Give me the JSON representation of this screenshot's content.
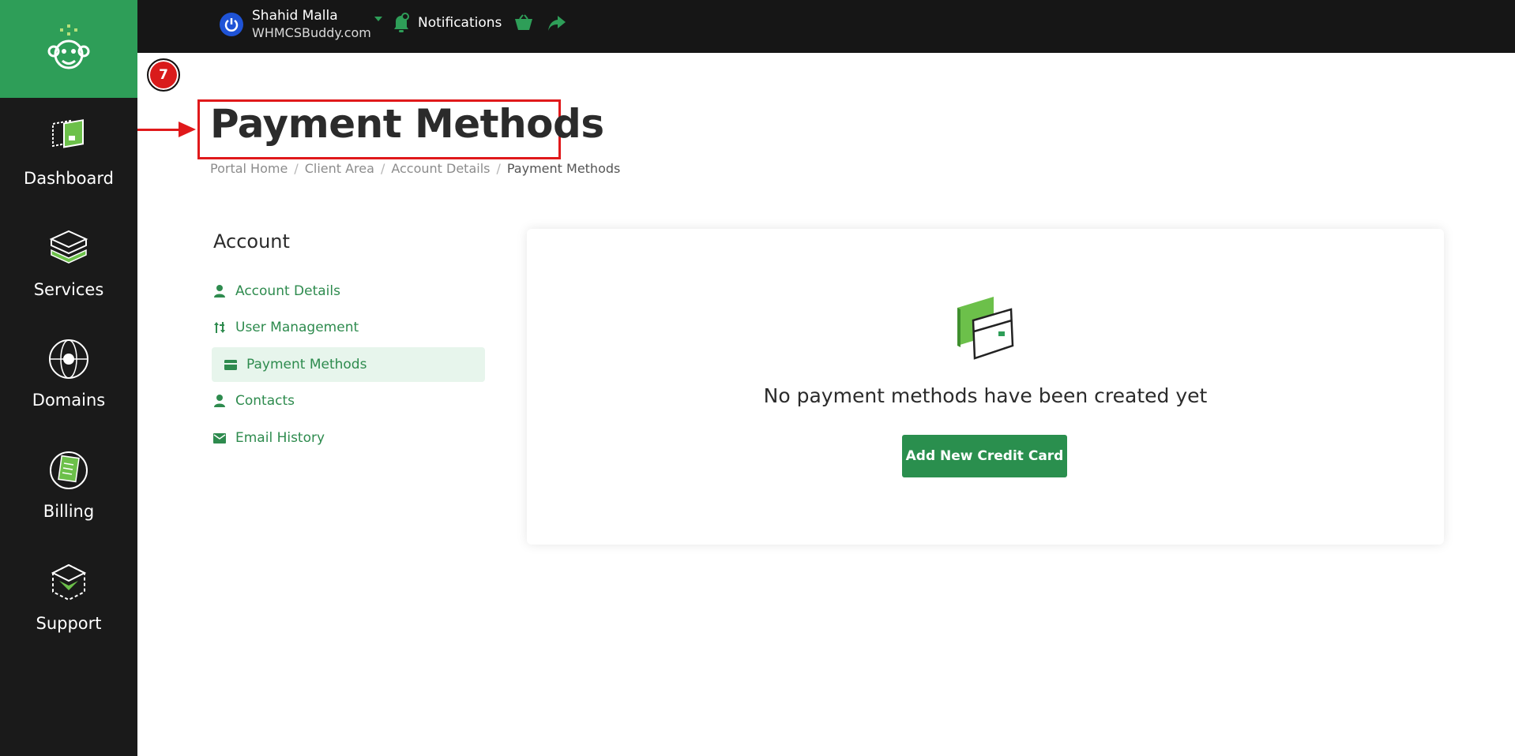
{
  "sidebar": {
    "logo": "monkey-logo",
    "items": [
      {
        "label": "Dashboard",
        "icon": "dashboard-icon"
      },
      {
        "label": "Services",
        "icon": "services-icon"
      },
      {
        "label": "Domains",
        "icon": "globe-icon"
      },
      {
        "label": "Billing",
        "icon": "billing-icon"
      },
      {
        "label": "Support",
        "icon": "support-icon"
      }
    ]
  },
  "topbar": {
    "user_name": "Shahid Malla",
    "user_site": "WHMCSBuddy.com",
    "notifications_label": "Notifications"
  },
  "annotation": {
    "step_number": "7"
  },
  "page": {
    "title": "Payment Methods",
    "breadcrumb": [
      "Portal Home",
      "Client Area",
      "Account Details",
      "Payment Methods"
    ]
  },
  "account_menu": {
    "heading": "Account",
    "items": [
      {
        "label": "Account Details",
        "icon": "user-icon"
      },
      {
        "label": "User Management",
        "icon": "sort-arrows-icon"
      },
      {
        "label": "Payment Methods",
        "icon": "credit-card-icon",
        "active": true
      },
      {
        "label": "Contacts",
        "icon": "user-icon"
      },
      {
        "label": "Email History",
        "icon": "envelope-icon"
      }
    ]
  },
  "card": {
    "empty_message": "No payment methods have been created yet",
    "add_button_label": "Add New Credit Card"
  },
  "colors": {
    "brand_green": "#2e9e58",
    "button_green": "#2a8f4e",
    "link_green": "#2e8b4e",
    "sidebar_bg": "#1a1a1a",
    "annotation_red": "#e0191b"
  }
}
